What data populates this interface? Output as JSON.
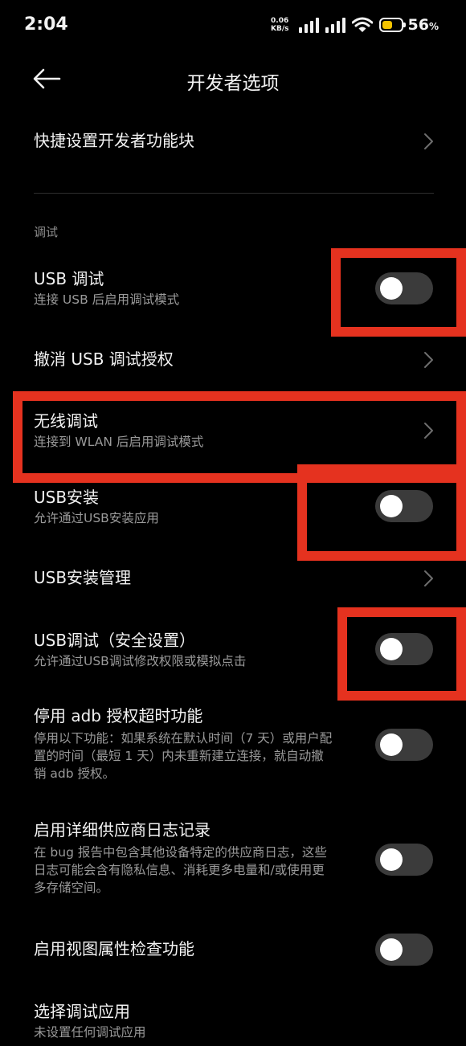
{
  "status_bar": {
    "time": "2:04",
    "net_speed_value": "0.06",
    "net_speed_unit": "KB/s",
    "battery_percent": "56",
    "battery_suffix": "%",
    "battery_level": 0.56,
    "battery_color": "#f5c400"
  },
  "header": {
    "back_icon": "arrow-left-icon",
    "title": "开发者选项"
  },
  "quick_settings": {
    "title": "快捷设置开发者功能块"
  },
  "section": {
    "label": "调试"
  },
  "items": [
    {
      "title": "USB 调试",
      "subtitle": "连接 USB 后启用调试模式",
      "control": "toggle",
      "on": false
    },
    {
      "title": "撤消 USB 调试授权",
      "subtitle": "",
      "control": "chevron"
    },
    {
      "title": "无线调试",
      "subtitle": "连接到 WLAN 后启用调试模式",
      "control": "chevron"
    },
    {
      "title": "USB安装",
      "subtitle": "允许通过USB安装应用",
      "control": "toggle",
      "on": false
    },
    {
      "title": "USB安装管理",
      "subtitle": "",
      "control": "chevron"
    },
    {
      "title": "USB调试（安全设置）",
      "subtitle": "允许通过USB调试修改权限或模拟点击",
      "control": "toggle",
      "on": false
    },
    {
      "title": "停用 adb 授权超时功能",
      "subtitle_lines": [
        "停用以下功能：如果系统在默认时间（7 天）或用户配",
        "置的时间（最短 1 天）内未重新建立连接，就自动撤",
        "销 adb 授权。"
      ],
      "control": "toggle",
      "on": false
    },
    {
      "title": "启用详细供应商日志记录",
      "subtitle_lines": [
        "在 bug 报告中包含其他设备特定的供应商日志，这些",
        "日志可能会含有隐私信息、消耗更多电量和/或使用更",
        "多存储空间。"
      ],
      "control": "toggle",
      "on": false
    },
    {
      "title": "启用视图属性检查功能",
      "subtitle": "",
      "control": "toggle",
      "on": false
    },
    {
      "title": "选择调试应用",
      "subtitle": "未设置任何调试应用",
      "control": "none"
    }
  ],
  "colors": {
    "background": "#000000",
    "toggle_off_track": "#3b3b3b",
    "highlight_box": "#e5321f"
  }
}
